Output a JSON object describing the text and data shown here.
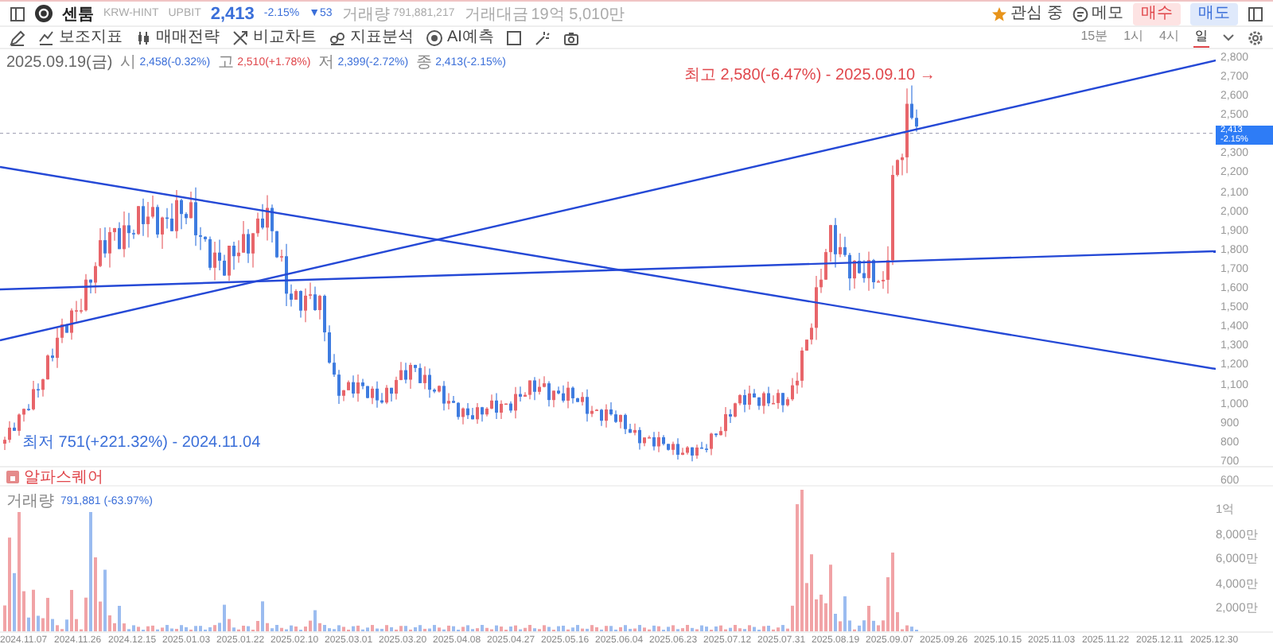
{
  "header": {
    "symbol_name": "센툼",
    "market": "KRW-HINT",
    "exchange": "UPBIT",
    "price": "2,413",
    "change_rate": "-2.15%",
    "change": "▼53",
    "volume_label": "거래량",
    "volume": "791,881,217",
    "value_label": "거래대금",
    "value": "19억 5,010만"
  },
  "actions": [
    {
      "label": "관심 중",
      "kind": "watch"
    },
    {
      "label": "메모",
      "kind": "memo"
    },
    {
      "label": "매수",
      "kind": "buy"
    },
    {
      "label": "매도",
      "kind": "sell"
    }
  ],
  "toolbar": [
    {
      "label": "보조지표",
      "kind": "indicator"
    },
    {
      "label": "매매전략",
      "kind": "strategy"
    },
    {
      "label": "비교차트",
      "kind": "compare"
    },
    {
      "label": "지표분석",
      "kind": "analysis"
    },
    {
      "label": "AI예측",
      "kind": "ai"
    }
  ],
  "timeframes": [
    {
      "label": "15분",
      "selected": false
    },
    {
      "label": "1시",
      "selected": false
    },
    {
      "label": "4시",
      "selected": false
    },
    {
      "label": "일",
      "selected": true
    }
  ],
  "ohlc": {
    "date": "2025.09.19(금)",
    "items": [
      {
        "label": "시",
        "value": "2,458(-0.32%)",
        "color": "#3b6fd9"
      },
      {
        "label": "고",
        "value": "2,510(+1.78%)",
        "color": "#e0474c"
      },
      {
        "label": "저",
        "value": "2,399(-2.72%)",
        "color": "#3b6fd9"
      },
      {
        "label": "종",
        "value": "2,413(-2.15%)",
        "color": "#3b6fd9"
      }
    ]
  },
  "price_axis_upper": [
    "2,800",
    "2,700",
    "2,600",
    "2,500"
  ],
  "price_axis_lower": [
    "2,300",
    "2,200",
    "2,100",
    "2,000",
    "1,900",
    "1,800",
    "1,700",
    "1,600",
    "1,500",
    "1,400",
    "1,300",
    "1,200",
    "1,100",
    "1,000",
    "900",
    "800",
    "700",
    "600"
  ],
  "current_price": {
    "price": "2,413",
    "change": "-2.15%"
  },
  "high_marker": "최고 2,580(-6.47%) - 2025.09.10 →",
  "low_marker": "최저 751(+221.32%) - 2024.11.04",
  "indicator_panel": {
    "title": "알파스퀘어"
  },
  "volume": {
    "label": "거래량",
    "value": "791,881 (-63.97%)",
    "axis": [
      "1억",
      "8,000만",
      "6,000만",
      "4,000만",
      "2,000만"
    ]
  },
  "date_axis": [
    "2024.11.07",
    "2024.11.26",
    "2024.12.15",
    "2025.01.03",
    "2025.01.22",
    "2025.02.10",
    "2025.03.01",
    "2025.03.20",
    "2025.04.08",
    "2025.04.27",
    "2025.05.16",
    "2025.06.04",
    "2025.06.23",
    "2025.07.12",
    "2025.07.31",
    "2025.08.19",
    "2025.09.07",
    "2025.09.26",
    "2025.10.15",
    "2025.11.03",
    "2025.11.22",
    "2025.12.11",
    "2025.12.30"
  ]
}
